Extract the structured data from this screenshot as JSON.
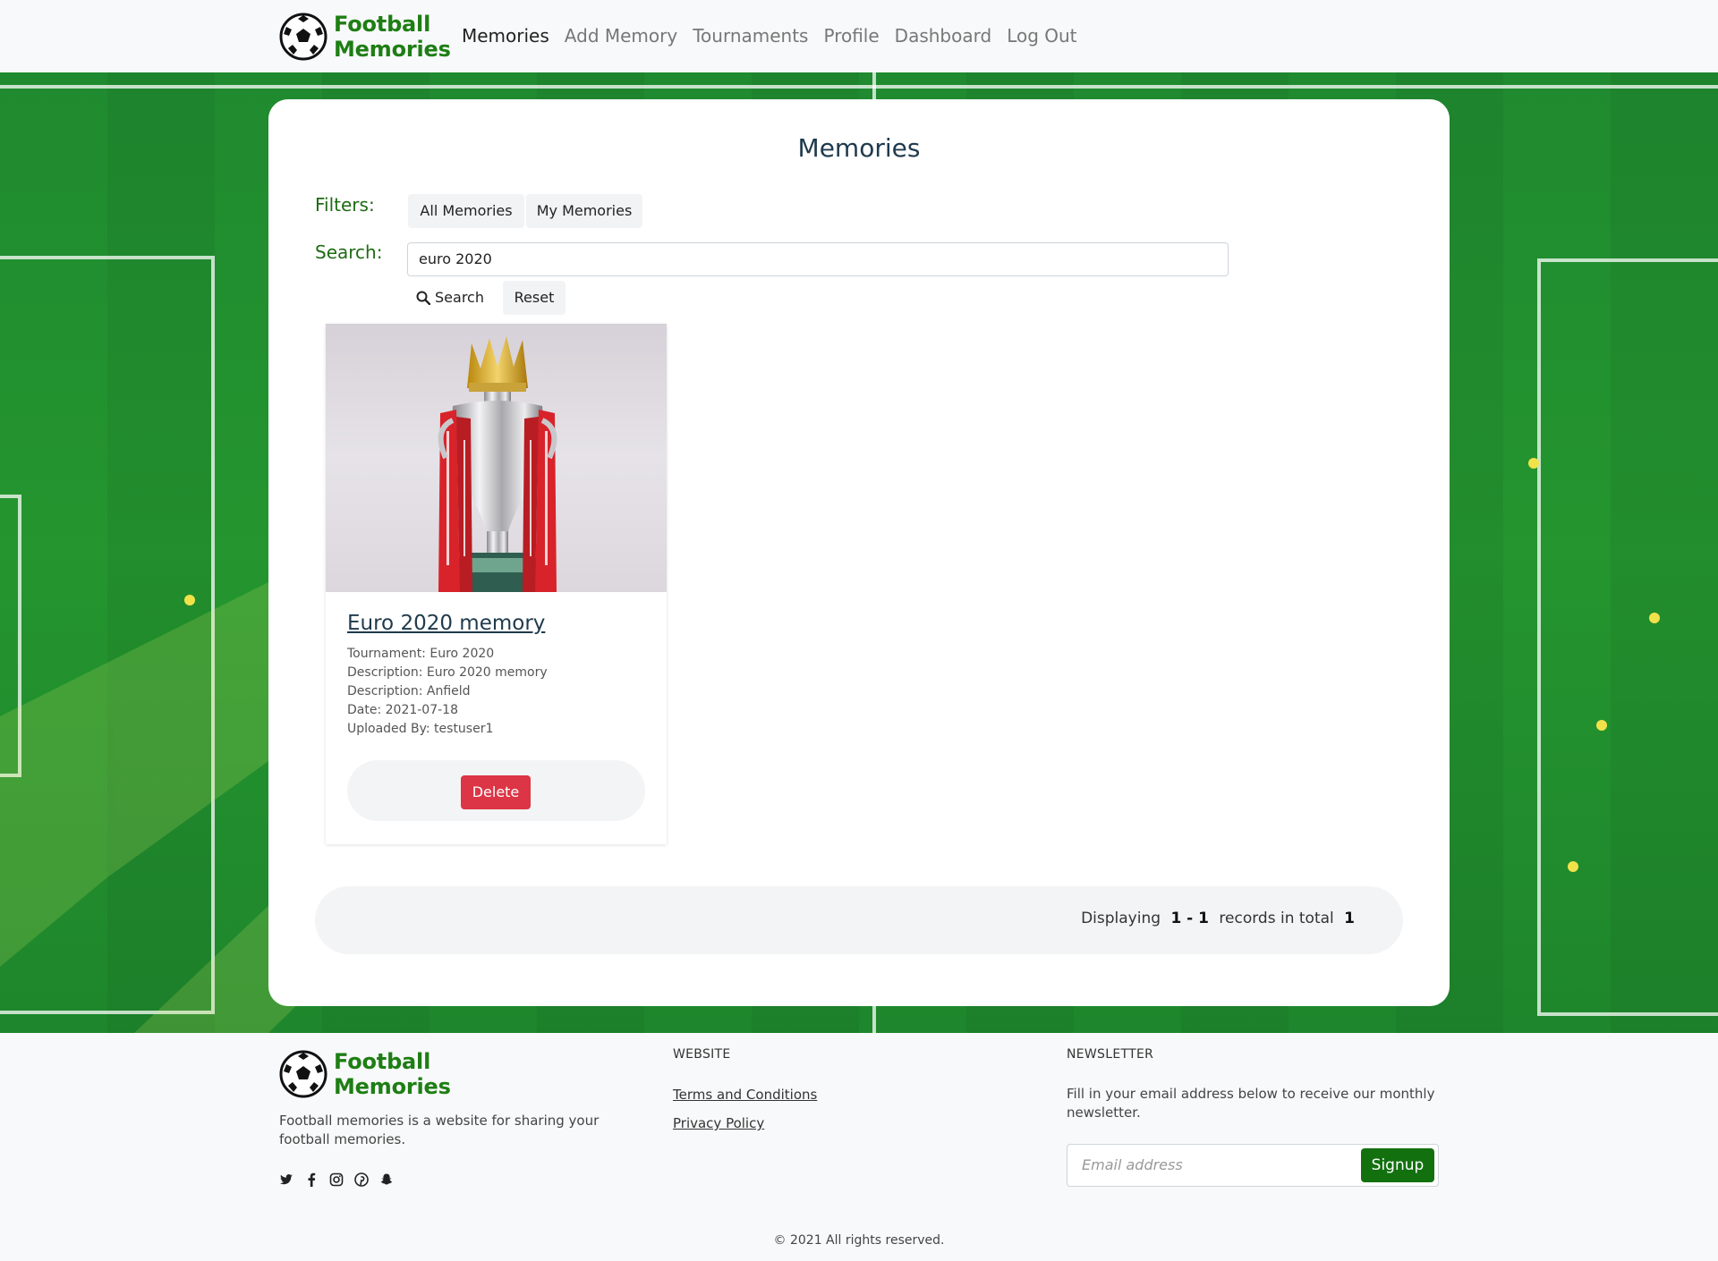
{
  "brand": {
    "line1": "Football",
    "line2": "Memories"
  },
  "nav": {
    "items": [
      "Memories",
      "Add Memory",
      "Tournaments",
      "Profile",
      "Dashboard",
      "Log Out"
    ],
    "active": "Memories"
  },
  "page": {
    "title": "Memories",
    "filters_label": "Filters:",
    "filter_all": "All Memories",
    "filter_my": "My Memories",
    "search_label": "Search:",
    "search_value": "euro 2020",
    "search_button": "Search",
    "reset_button": "Reset"
  },
  "memories": [
    {
      "title": "Euro 2020 memory",
      "tournament": "Tournament: Euro 2020",
      "description1": "Description: Euro 2020 memory",
      "description2": "Description: Anfield",
      "date": "Date: 2021-07-18",
      "uploaded_by": "Uploaded By: testuser1",
      "delete_label": "Delete",
      "image": "premier-league-trophy"
    }
  ],
  "pagination": {
    "prefix": "Displaying",
    "range": "1 - 1",
    "middle": "records in total",
    "total": "1"
  },
  "footer": {
    "description": "Football memories is a website for sharing your football memories.",
    "website_heading": "WEBSITE",
    "links": [
      "Terms and Conditions",
      "Privacy Policy"
    ],
    "newsletter_heading": "NEWSLETTER",
    "newsletter_text": "Fill in your email address below to receive our monthly newsletter.",
    "email_placeholder": "Email address",
    "signup_label": "Signup",
    "socials": [
      "twitter-icon",
      "facebook-icon",
      "instagram-icon",
      "pinterest-icon",
      "snapchat-icon"
    ],
    "copyright": "© 2021 All rights reserved."
  },
  "colors": {
    "brand_green": "#1e7e14",
    "signup_green": "#13700f",
    "delete_red": "#dc3545",
    "title_navy": "#1f3a4d"
  }
}
